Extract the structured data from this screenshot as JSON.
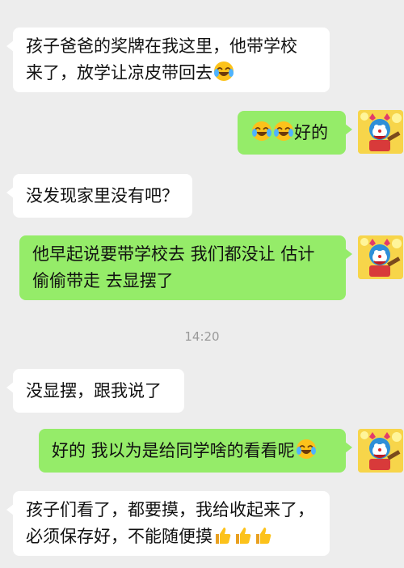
{
  "messages": [
    {
      "side": "in",
      "lines": [
        "孩子爸爸的奖牌在我这里，他带学校",
        "来了，放学让凉皮带回去"
      ],
      "trailing_emoji": [
        "laugh-cry-icon"
      ]
    },
    {
      "side": "out",
      "leading_emoji": [
        "laugh-cry-icon",
        "laugh-cry-icon"
      ],
      "lines": [
        "好的"
      ]
    },
    {
      "side": "in",
      "lines": [
        "没发现家里没有吧？"
      ]
    },
    {
      "side": "out",
      "lines": [
        "他早起说要带学校去 我们都没让 估计",
        "偷偷带走 去显摆了"
      ]
    },
    {
      "side": "in",
      "lines": [
        "没显摆，跟我说了"
      ]
    },
    {
      "side": "out",
      "lines": [
        "好的 我以为是给同学啥的看看呢"
      ],
      "trailing_emoji": [
        "laugh-cry-icon"
      ]
    },
    {
      "side": "in",
      "lines": [
        "孩子们看了，都要摸，我给收起来了，",
        "必须保存好，不能随便摸"
      ],
      "trailing_emoji": [
        "thumbs-up-icon",
        "thumbs-up-icon",
        "thumbs-up-icon"
      ]
    }
  ],
  "timestamp": "14:20",
  "colors": {
    "incoming": "#ffffff",
    "outgoing": "#95ec69",
    "background": "#ededed"
  }
}
